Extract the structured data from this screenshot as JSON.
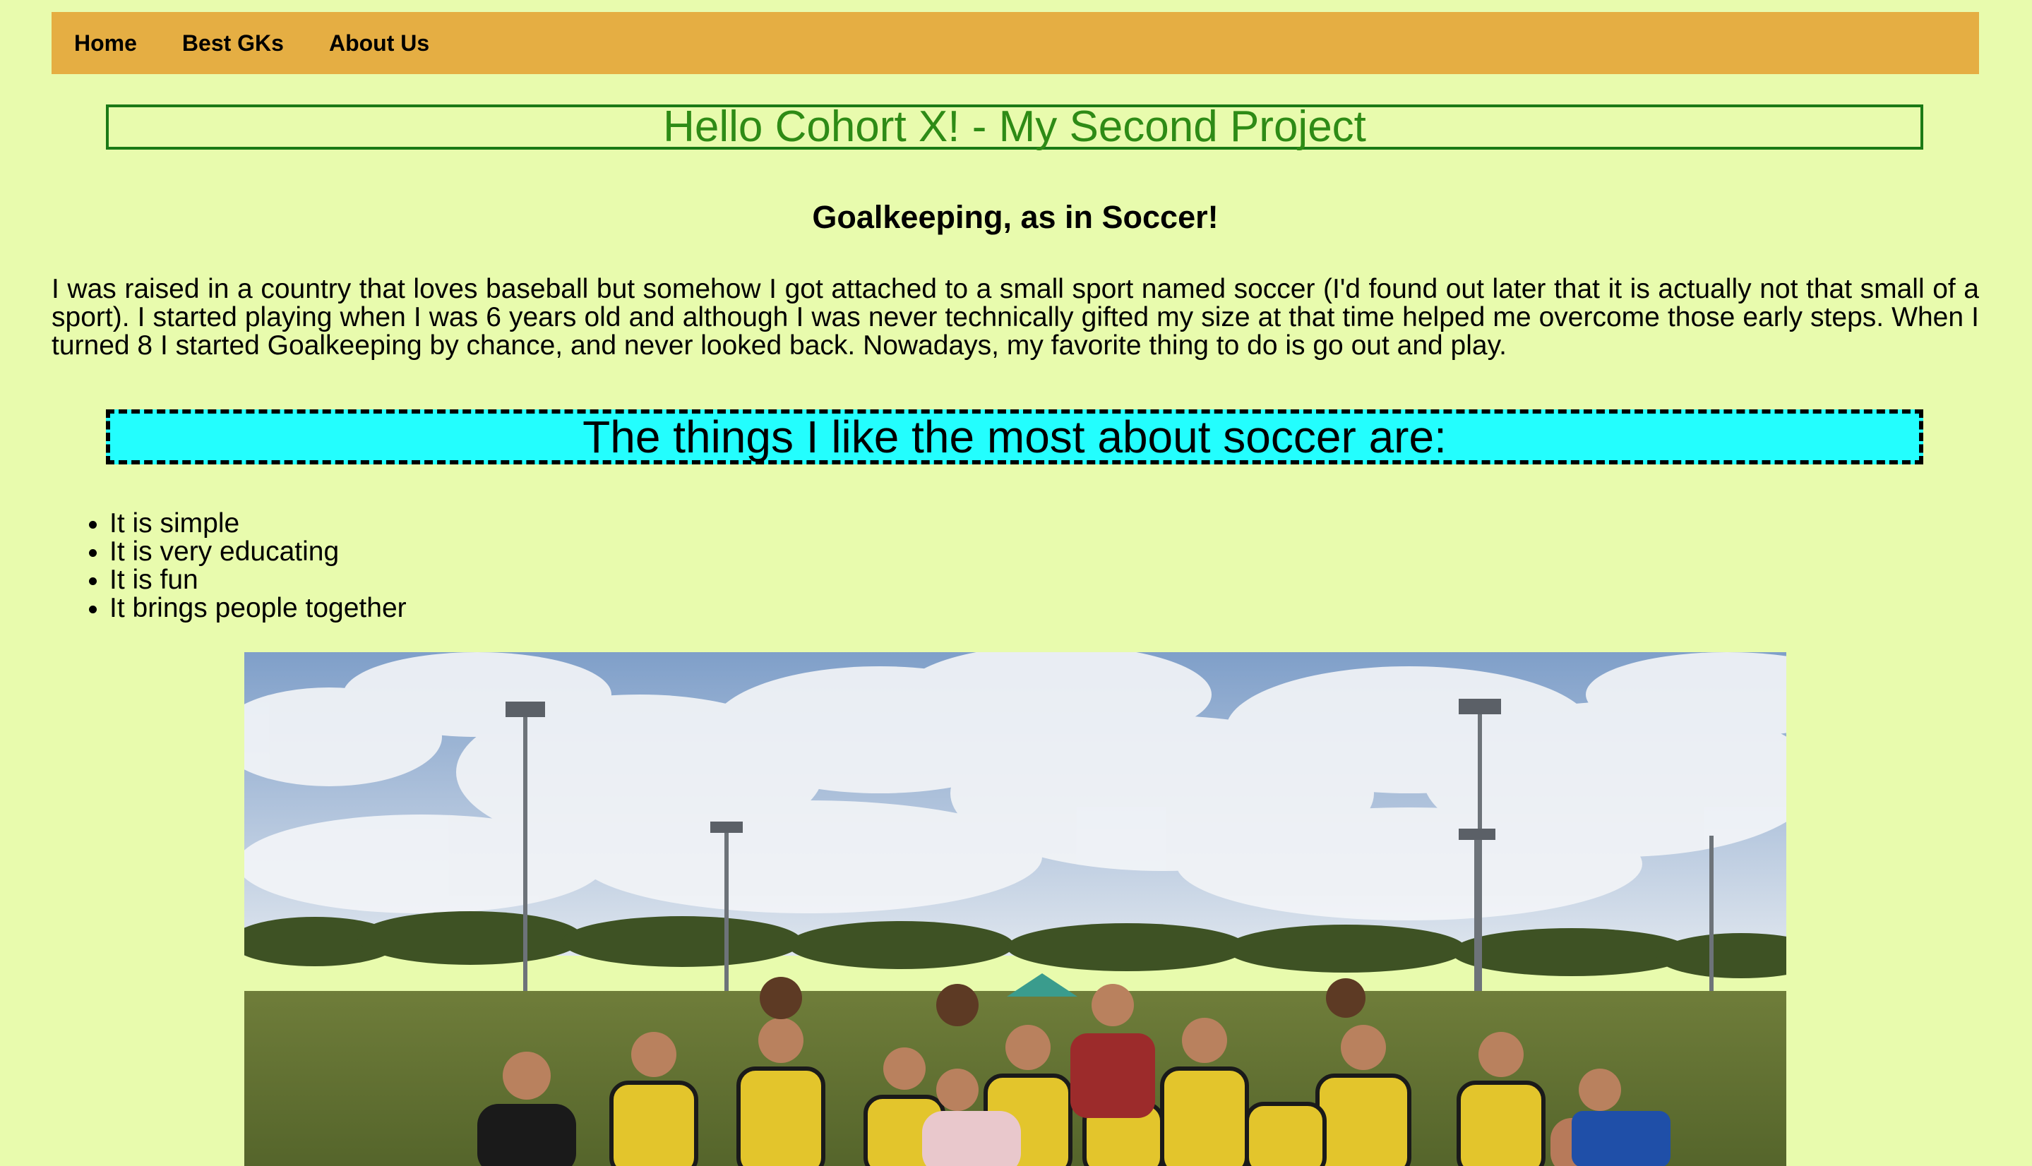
{
  "nav": {
    "items": [
      {
        "label": "Home"
      },
      {
        "label": "Best GKs"
      },
      {
        "label": "About Us"
      }
    ]
  },
  "header": {
    "title": "Hello Cohort X! - My Second Project"
  },
  "main": {
    "subtitle": "Goalkeeping, as in Soccer!",
    "paragraph": "I was raised in a country that loves baseball but somehow I got attached to a small sport named soccer (I'd found out later that it is actually not that small of a sport). I started playing when I was 6 years old and although I was never technically gifted my size at that time helped me overcome those early steps. When I turned 8 I started Goalkeeping by chance, and never looked back. Nowadays, my favorite thing to do is go out and play.",
    "likes_heading": "The things I like the most about soccer are:",
    "likes": [
      "It is simple",
      "It is very educating",
      "It is fun",
      "It brings people together"
    ]
  },
  "colors": {
    "page_background": "#e8fbad",
    "navbar": "#e5ae43",
    "title_text": "#2e8b16",
    "title_border": "#1b7a16",
    "likes_background": "#23fefe"
  },
  "image": {
    "subject": "team-photo"
  }
}
